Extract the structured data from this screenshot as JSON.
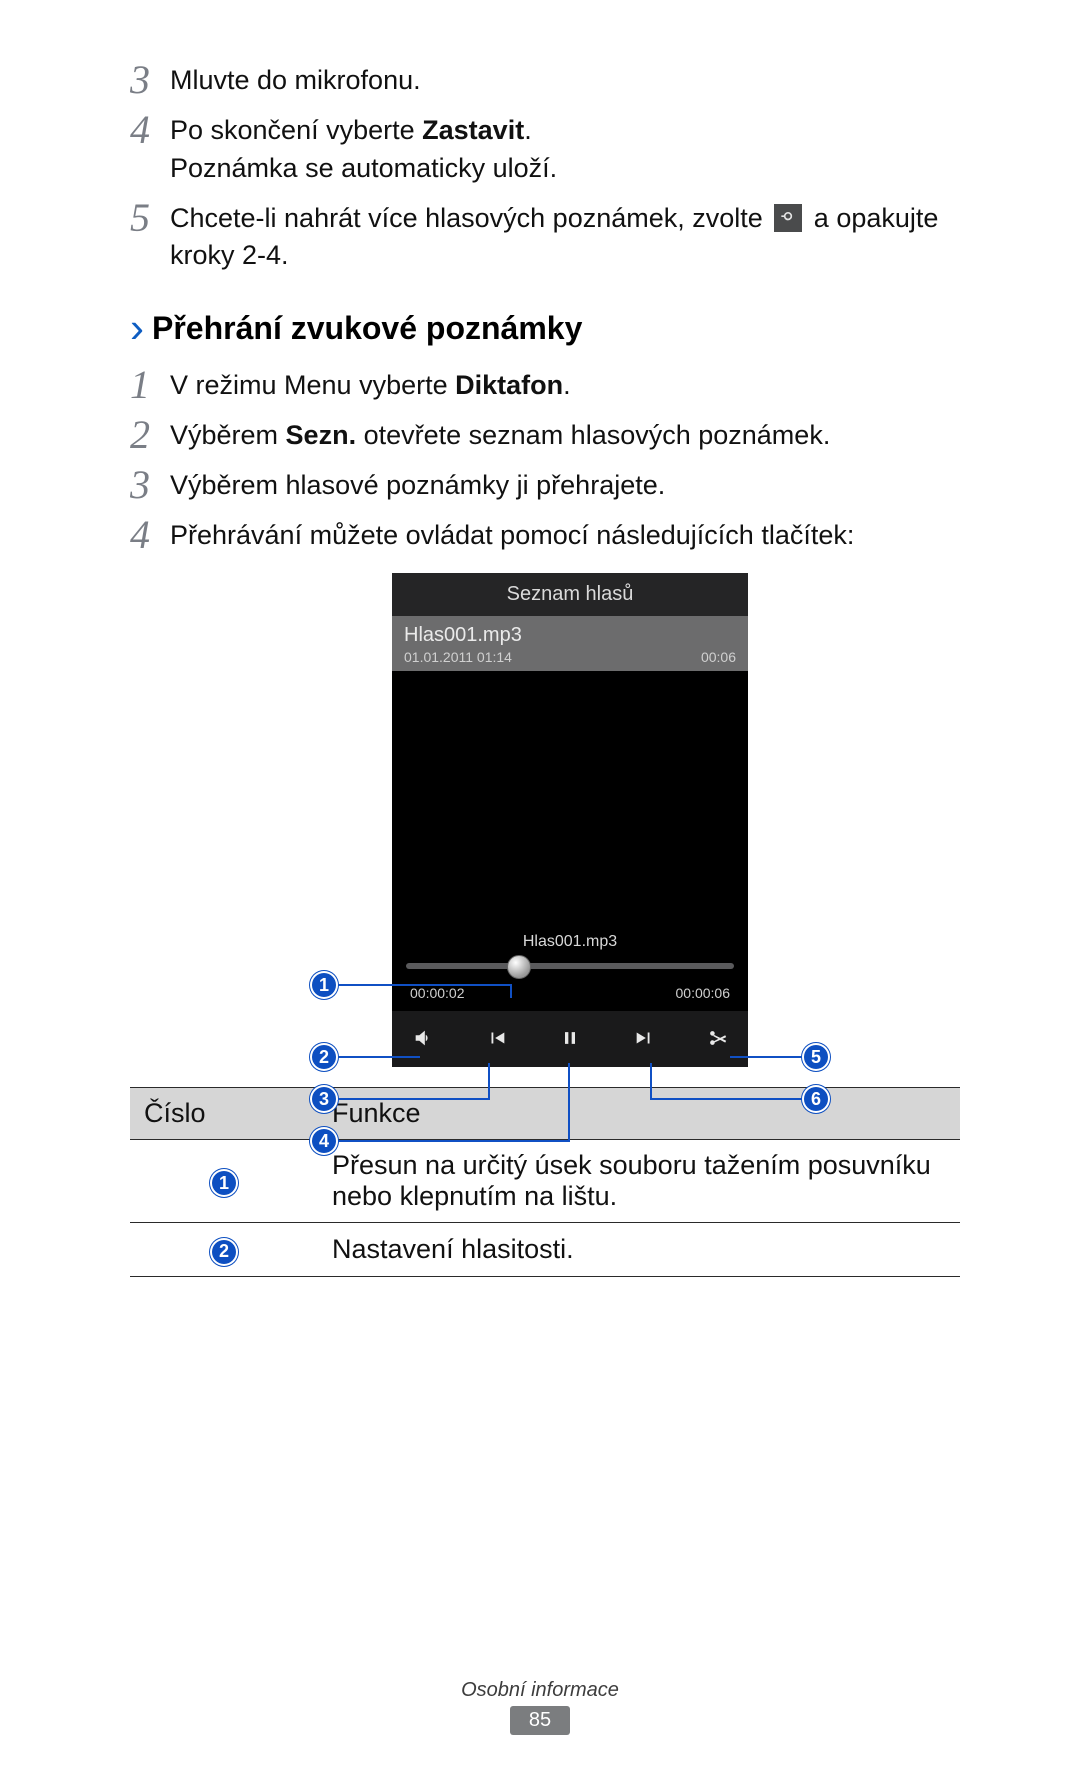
{
  "stepsA": [
    {
      "n": "3",
      "lines": [
        "Mluvte do mikrofonu."
      ]
    },
    {
      "n": "4",
      "lines": [
        "Po skončení vyberte <b>Zastavit</b>.",
        "Poznámka se automaticky uloží."
      ]
    },
    {
      "n": "5",
      "lines": [
        "Chcete-li nahrát více hlasových poznámek, zvolte {record} a opakujte kroky 2-4."
      ]
    }
  ],
  "section": {
    "title": "Přehrání zvukové poznámky"
  },
  "stepsB": [
    {
      "n": "1",
      "lines": [
        "V režimu Menu vyberte <b>Diktafon</b>."
      ]
    },
    {
      "n": "2",
      "lines": [
        "Výběrem <b>Sezn.</b> otevřete seznam hlasových poznámek."
      ]
    },
    {
      "n": "3",
      "lines": [
        "Výběrem hlasové poznámky ji přehrajete."
      ]
    },
    {
      "n": "4",
      "lines": [
        "Přehrávání můžete ovládat pomocí následujících tlačítek:"
      ]
    }
  ],
  "phone": {
    "header": "Seznam hlasů",
    "file": "Hlas001.mp3",
    "datetime": "01.01.2011 01:14",
    "dur": "00:06",
    "nowplaying": "Hlas001.mp3",
    "t_elapsed": "00:00:02",
    "t_total": "00:00:06"
  },
  "callouts": {
    "c1": "1",
    "c2": "2",
    "c3": "3",
    "c4": "4",
    "c5": "5",
    "c6": "6"
  },
  "table": {
    "h1": "Číslo",
    "h2": "Funkce",
    "rows": [
      {
        "n": "1",
        "desc": "Přesun na určitý úsek souboru tažením posuvníku nebo klepnutím na lištu."
      },
      {
        "n": "2",
        "desc": "Nastavení hlasitosti."
      }
    ]
  },
  "footer": {
    "section": "Osobní informace",
    "page": "85"
  }
}
